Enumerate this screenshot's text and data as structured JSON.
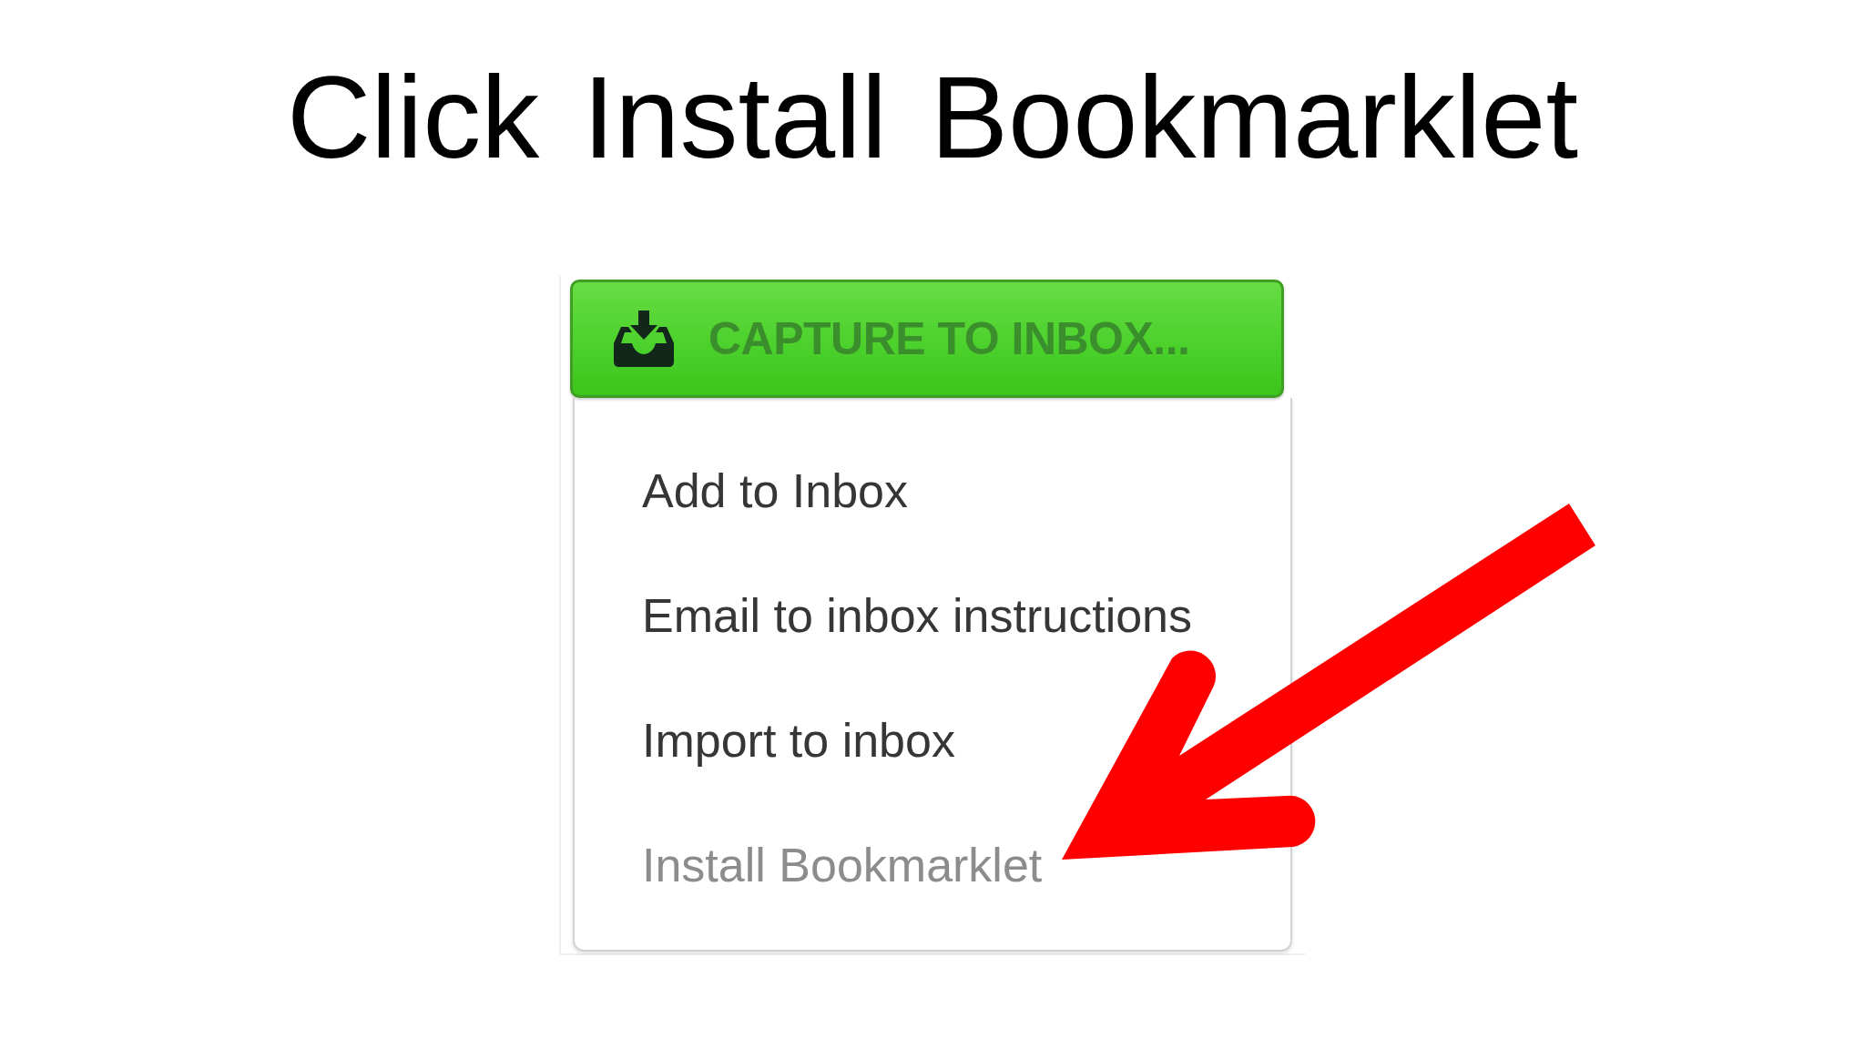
{
  "title": "Click Install Bookmarklet",
  "capture_button": {
    "label": "CAPTURE TO INBOX..."
  },
  "menu": {
    "items": [
      {
        "label": "Add to Inbox",
        "disabled": false
      },
      {
        "label": "Email to inbox instructions",
        "disabled": false
      },
      {
        "label": "Import to inbox",
        "disabled": false
      },
      {
        "label": "Install Bookmarklet",
        "disabled": true
      }
    ]
  }
}
